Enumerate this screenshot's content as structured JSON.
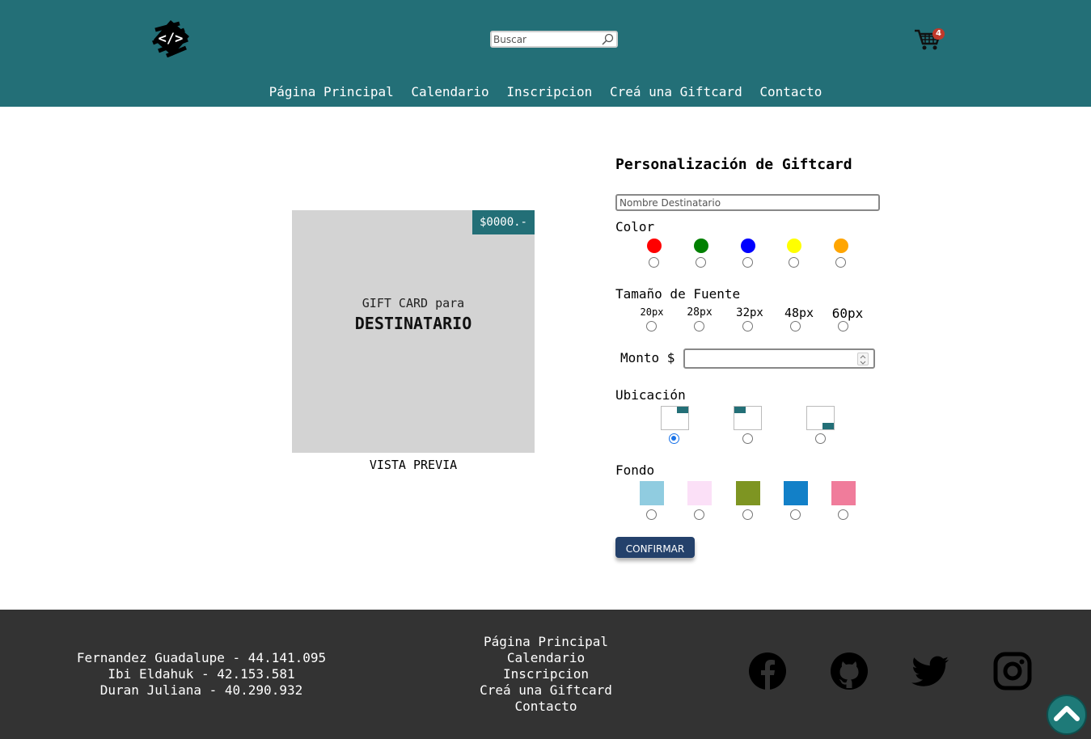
{
  "header": {
    "search_placeholder": "Buscar",
    "cart_count": "4",
    "nav": [
      "Página Principal",
      "Calendario",
      "Inscripcion",
      "Creá una Giftcard",
      "Contacto"
    ]
  },
  "preview": {
    "price": "$0000.-",
    "gift_for": "GIFT CARD para",
    "recipient": "DESTINATARIO",
    "label": "VISTA PREVIA"
  },
  "form": {
    "title": "Personalización de Giftcard",
    "name_placeholder": "Nombre Destinatario",
    "color_label": "Color",
    "colors": [
      "#ff0000",
      "#008000",
      "#0000ff",
      "#ffff00",
      "#ffa500"
    ],
    "font_size_label": "Tamaño de Fuente",
    "font_sizes": [
      "20px",
      "28px",
      "32px",
      "48px",
      "60px"
    ],
    "monto_label": "Monto $",
    "location_label": "Ubicación",
    "location_options": [
      "top-right",
      "top-left",
      "bottom-right"
    ],
    "location_selected": "top-right",
    "background_label": "Fondo",
    "backgrounds": [
      "#90cce0",
      "#fbe0f7",
      "#7e9522",
      "#1280c8",
      "#f07c9b"
    ],
    "confirm_label": "CONFIRMAR"
  },
  "footer": {
    "authors": [
      "Fernandez Guadalupe - 44.141.095",
      "Ibi Eldahuk - 42.153.581",
      "Duran Juliana - 40.290.932"
    ],
    "nav": [
      "Página Principal",
      "Calendario",
      "Inscripcion",
      "Creá una Giftcard",
      "Contacto"
    ],
    "social_icons": [
      "facebook-icon",
      "github-icon",
      "twitter-icon",
      "instagram-icon"
    ]
  },
  "colors": {
    "header_bg": "#236f77",
    "footer_bg": "#333333",
    "confirm_bg": "#24416b",
    "card_bg": "#d3d3d3"
  }
}
